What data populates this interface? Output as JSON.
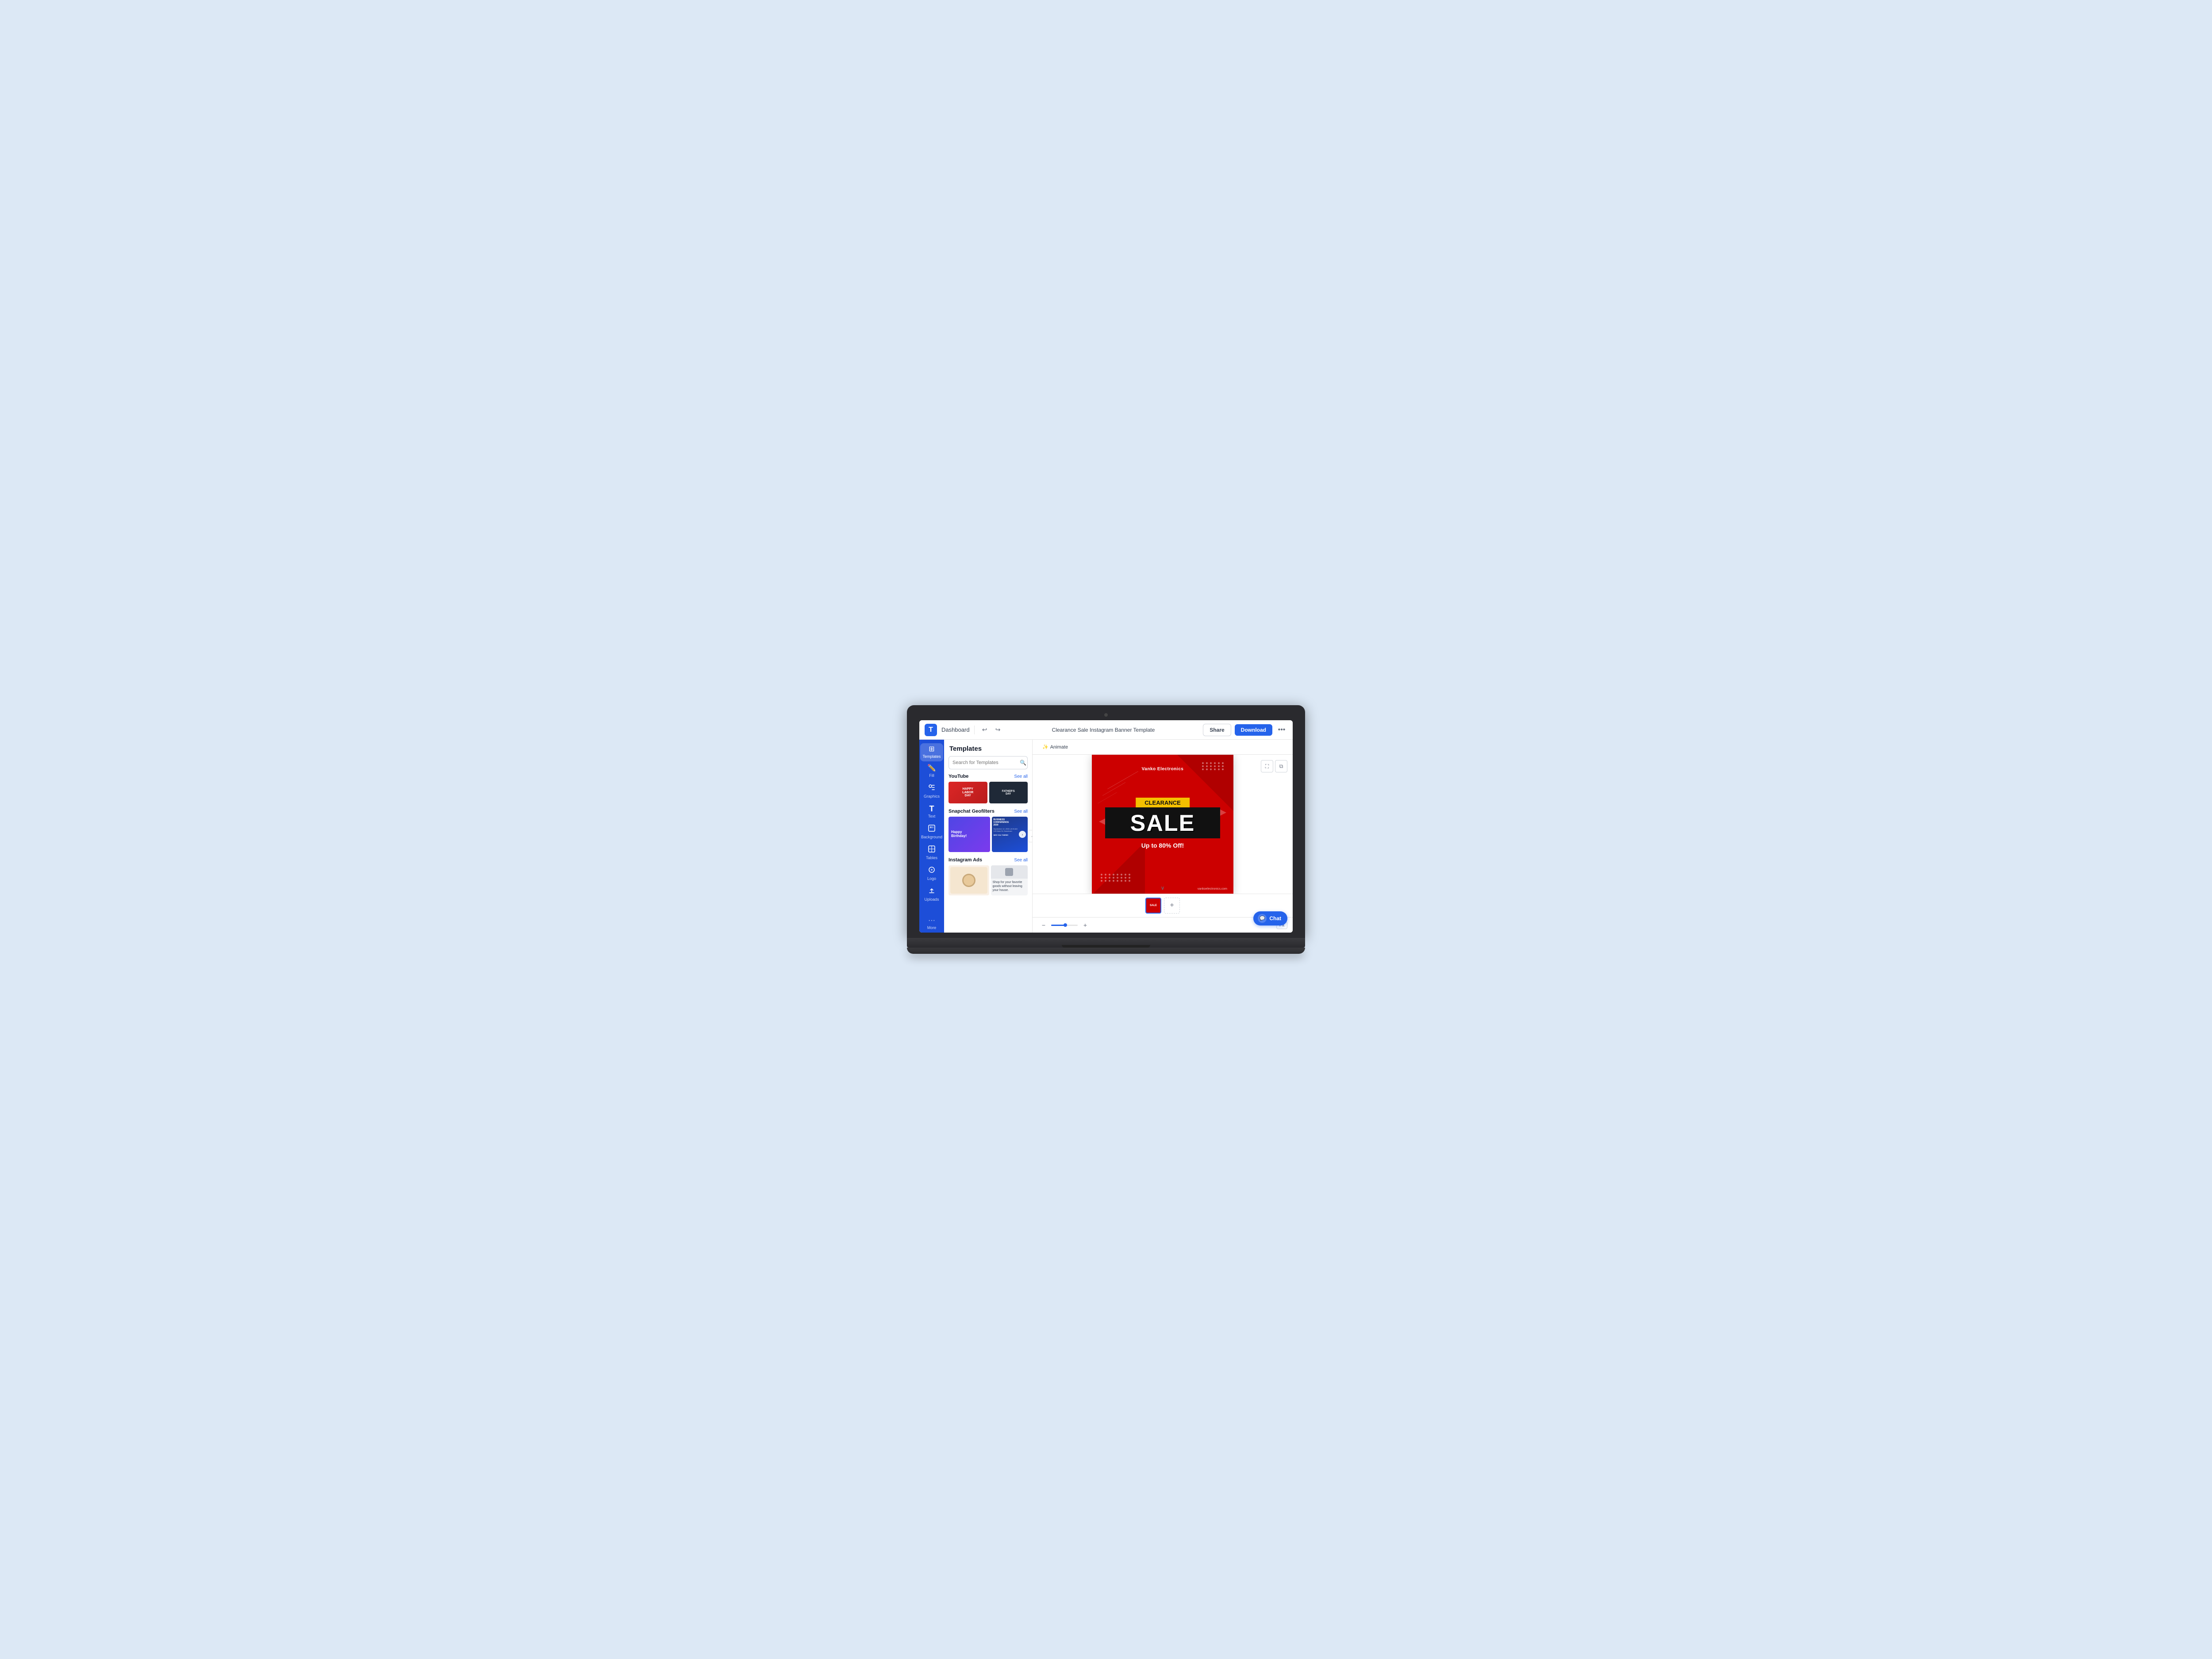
{
  "app": {
    "logo": "T",
    "logo_color": "#2563eb"
  },
  "topbar": {
    "dashboard_label": "Dashboard",
    "doc_title": "Clearance Sale Instagram Banner Template",
    "share_label": "Share",
    "download_label": "Download",
    "more_icon": "•••"
  },
  "rail": {
    "items": [
      {
        "id": "templates",
        "icon": "⊞",
        "label": "Templates",
        "active": true
      },
      {
        "id": "fill",
        "icon": "✏",
        "label": "Fill"
      },
      {
        "id": "graphics",
        "icon": "⬡",
        "label": "Graphics"
      },
      {
        "id": "text",
        "icon": "T",
        "label": "Text"
      },
      {
        "id": "background",
        "icon": "▦",
        "label": "Background"
      },
      {
        "id": "tables",
        "icon": "⊞",
        "label": "Tables"
      },
      {
        "id": "logo",
        "icon": "◎",
        "label": "Logo"
      },
      {
        "id": "uploads",
        "icon": "↑",
        "label": "Uploads"
      },
      {
        "id": "more",
        "icon": "•••",
        "label": "More"
      }
    ]
  },
  "templates_panel": {
    "title": "Templates",
    "search_placeholder": "Search for Templates",
    "sections": [
      {
        "id": "youtube",
        "title": "YouTube",
        "see_all": "See all",
        "thumbs": [
          {
            "id": "yt1",
            "text": "HAPPY LABOR DAY",
            "style": "red"
          },
          {
            "id": "yt2",
            "text": "FATHER'S DAY",
            "style": "dark"
          }
        ]
      },
      {
        "id": "snapchat",
        "title": "Snapchat Geofilters",
        "see_all": "See all",
        "thumbs": [
          {
            "id": "snap1",
            "text": "Happy Birthday!",
            "style": "purple"
          },
          {
            "id": "snap2",
            "text": "BUSINESS CONFERENCE 2030",
            "style": "blue"
          }
        ]
      },
      {
        "id": "instagram",
        "title": "Instagram Ads",
        "see_all": "See all",
        "thumbs": [
          {
            "id": "insta1",
            "text": "",
            "style": "beige"
          },
          {
            "id": "insta2",
            "text": "Shop for your favorite goods without leaving your house.",
            "style": "light"
          }
        ]
      }
    ]
  },
  "canvas": {
    "animate_label": "Animate",
    "brand_name": "Vanko Electronics",
    "clearance_label": "CLEARANCE",
    "sale_label": "SALE",
    "discount_label": "Up to 80% Off!",
    "website": "vankoelectronics.com",
    "filmstrip": {
      "add_label": "+"
    }
  },
  "toolbar_canvas": {
    "fit_label": "Fit"
  },
  "chat": {
    "label": "Chat"
  }
}
